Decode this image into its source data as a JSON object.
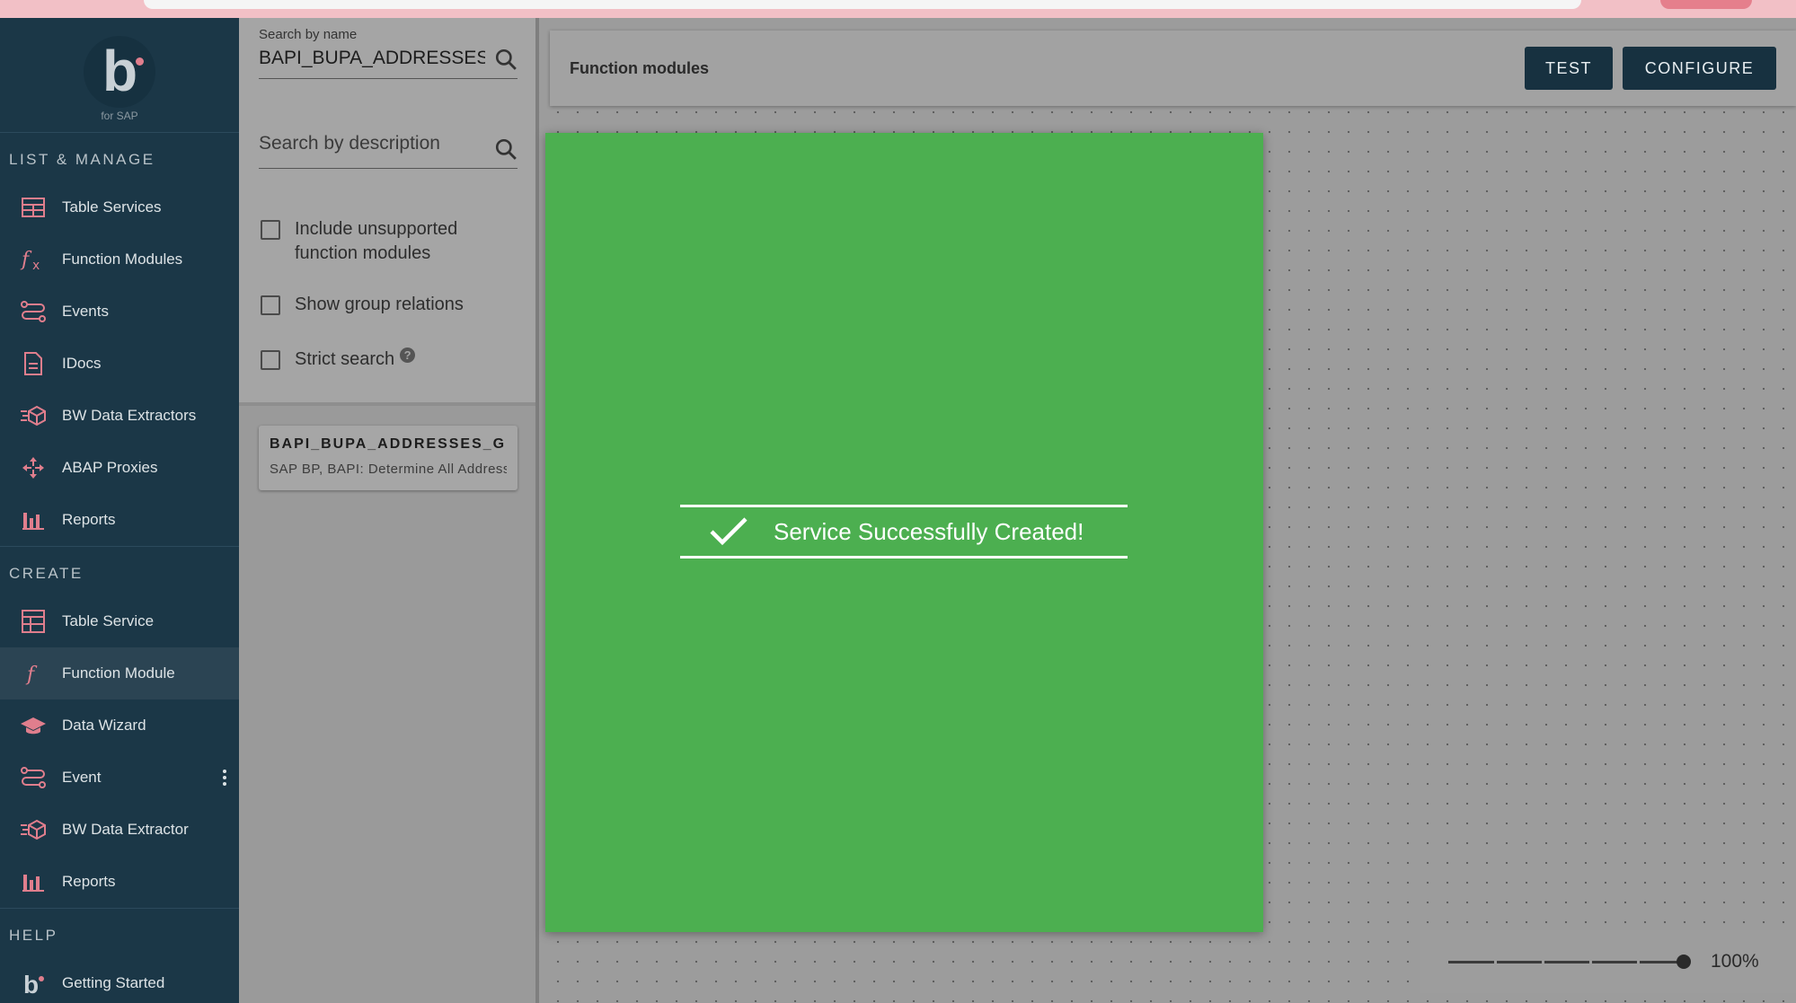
{
  "sidebar": {
    "logo_sub": "for SAP",
    "sections": {
      "list_manage": {
        "title": "LIST & MANAGE",
        "items": [
          {
            "label": "Table Services",
            "icon": "table-icon"
          },
          {
            "label": "Function Modules",
            "icon": "function-icon"
          },
          {
            "label": "Events",
            "icon": "event-icon"
          },
          {
            "label": "IDocs",
            "icon": "document-icon"
          },
          {
            "label": "BW Data Extractors",
            "icon": "extractor-icon"
          },
          {
            "label": "ABAP Proxies",
            "icon": "proxy-icon"
          },
          {
            "label": "Reports",
            "icon": "bar-chart-icon"
          }
        ]
      },
      "create": {
        "title": "CREATE",
        "items": [
          {
            "label": "Table Service",
            "icon": "table-icon"
          },
          {
            "label": "Function Module",
            "icon": "function-icon",
            "active": true
          },
          {
            "label": "Data Wizard",
            "icon": "wizard-hat-icon"
          },
          {
            "label": "Event",
            "icon": "event-icon"
          },
          {
            "label": "BW Data Extractor",
            "icon": "extractor-icon"
          },
          {
            "label": "Reports",
            "icon": "bar-chart-icon"
          }
        ]
      },
      "help": {
        "title": "HELP",
        "items": [
          {
            "label": "Getting Started",
            "icon": "logo-icon"
          }
        ]
      }
    }
  },
  "search": {
    "name_label": "Search by name",
    "name_value": "BAPI_BUPA_ADDRESSES_GET",
    "description_placeholder": "Search by description",
    "options": [
      {
        "label": "Include unsupported function modules",
        "checked": false
      },
      {
        "label": "Show group relations",
        "checked": false
      },
      {
        "label": "Strict search",
        "checked": false
      }
    ],
    "help_glyph": "?"
  },
  "results": [
    {
      "name": "BAPI_BUPA_ADDRESSES_GET",
      "description": "SAP BP, BAPI: Determine All Addresses"
    }
  ],
  "header": {
    "title": "Function modules",
    "test_label": "TEST",
    "configure_label": "CONFIGURE"
  },
  "modal": {
    "message": "Service Successfully Created!",
    "color": "#4caf50"
  },
  "zoom": {
    "value_label": "100%",
    "level": 1.0
  },
  "colors": {
    "sidebar_bg": "#1b3747",
    "accent_icon": "#e07e8d",
    "button_bg": "#173140"
  }
}
